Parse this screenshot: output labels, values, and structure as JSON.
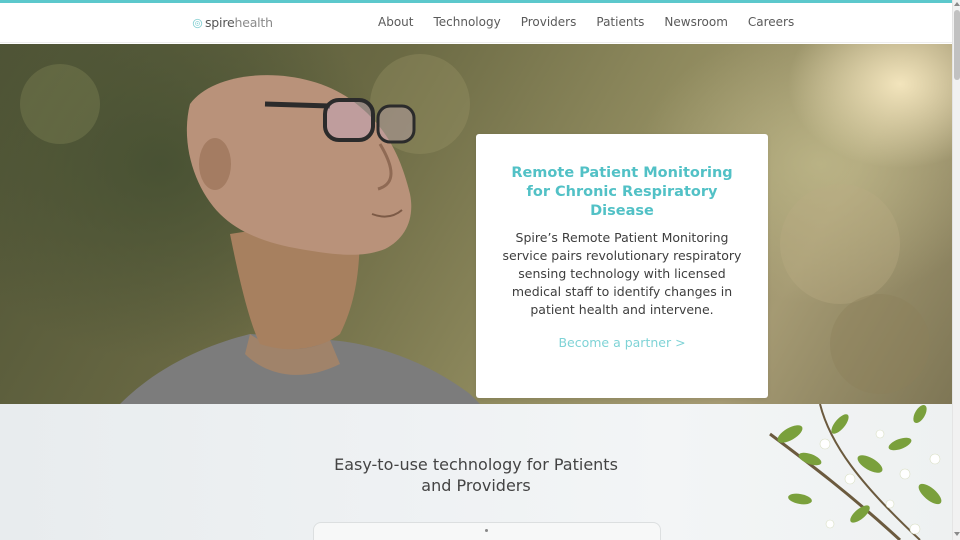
{
  "brand": {
    "logo_icon": "spire-flower-icon",
    "name_part1": "spire",
    "name_part2": "health",
    "accent_color": "#52c1c6"
  },
  "nav": {
    "items": [
      {
        "label": "About"
      },
      {
        "label": "Technology"
      },
      {
        "label": "Providers"
      },
      {
        "label": "Patients"
      },
      {
        "label": "Newsroom"
      },
      {
        "label": "Careers"
      }
    ]
  },
  "hero": {
    "image": "man-with-glasses-looking-up-photo",
    "card": {
      "title": "Remote Patient Monitoring for Chronic Respiratory Disease",
      "body": "Spire’s Remote Patient Monitoring service pairs revolutionary respiratory sensing technology with licensed medical staff to identify changes in patient health and intervene.",
      "link": "Become a partner >"
    }
  },
  "features": {
    "heading": "Easy-to-use technology for Patients and Providers",
    "image": "flowering-branch-photo"
  }
}
